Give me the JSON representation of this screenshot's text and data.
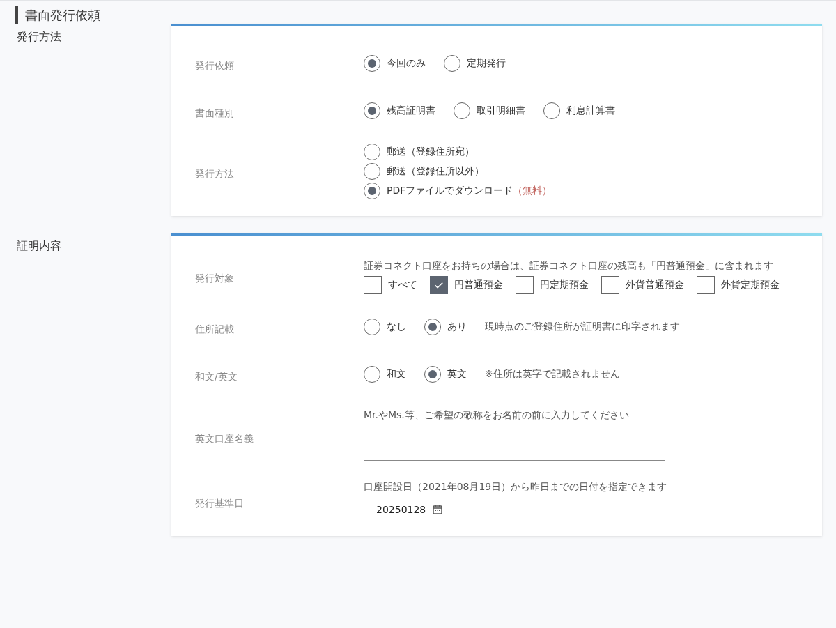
{
  "page_title": "書面発行依頼",
  "sections": [
    {
      "title": "発行方法",
      "rows": [
        {
          "label": "発行依頼",
          "kind": "radio",
          "options": [
            {
              "label": "今回のみ",
              "selected": true
            },
            {
              "label": "定期発行",
              "selected": false
            }
          ]
        },
        {
          "label": "書面種別",
          "kind": "radio",
          "options": [
            {
              "label": "残高証明書",
              "selected": true
            },
            {
              "label": "取引明細書",
              "selected": false
            },
            {
              "label": "利息計算書",
              "selected": false
            }
          ]
        },
        {
          "label": "発行方法",
          "kind": "radio_list",
          "options": [
            {
              "label": "郵送（登録住所宛）",
              "selected": false
            },
            {
              "label": "郵送（登録住所以外）",
              "selected": false
            },
            {
              "label": "PDFファイルでダウンロード",
              "note": "（無料）",
              "selected": true
            }
          ]
        }
      ]
    },
    {
      "title": "証明内容",
      "rows": [
        {
          "label": "発行対象",
          "kind": "checkbox",
          "hint": "証券コネクト口座をお持ちの場合は、証券コネクト口座の残高も「円普通預金」に含まれます",
          "options": [
            {
              "label": "すべて",
              "checked": false
            },
            {
              "label": "円普通預金",
              "checked": true
            },
            {
              "label": "円定期預金",
              "checked": false
            },
            {
              "label": "外貨普通預金",
              "checked": false
            },
            {
              "label": "外貨定期預金",
              "checked": false
            }
          ]
        },
        {
          "label": "住所記載",
          "kind": "radio",
          "note": "現時点のご登録住所が証明書に印字されます",
          "options": [
            {
              "label": "なし",
              "selected": false
            },
            {
              "label": "あり",
              "selected": true
            }
          ]
        },
        {
          "label": "和文/英文",
          "kind": "radio",
          "note": "※住所は英字で記載されません",
          "options": [
            {
              "label": "和文",
              "selected": false
            },
            {
              "label": "英文",
              "selected": true
            }
          ]
        },
        {
          "label": "英文口座名義",
          "kind": "text_input",
          "hint": "Mr.やMs.等、ご希望の敬称をお名前の前に入力してください"
        },
        {
          "label": "発行基準日",
          "kind": "date",
          "hint": "口座開設日（2021年08月19日）から昨日までの日付を指定できます",
          "value": "20250128"
        }
      ]
    }
  ]
}
